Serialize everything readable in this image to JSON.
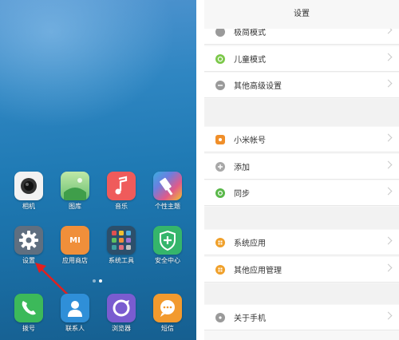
{
  "home": {
    "apps": [
      {
        "label": "相机",
        "icon": "camera-icon",
        "color": "#f2f2f2"
      },
      {
        "label": "图库",
        "icon": "gallery-icon",
        "color": "#8fd28a"
      },
      {
        "label": "音乐",
        "icon": "music-icon",
        "color": "#ef5b5b"
      },
      {
        "label": "个性主题",
        "icon": "theme-icon",
        "color": "#3aaee0"
      },
      {
        "label": "设置",
        "icon": "gear-icon",
        "color": "#5f6f80"
      },
      {
        "label": "应用商店",
        "icon": "app-store-icon",
        "color": "#f08f3a"
      },
      {
        "label": "系统工具",
        "icon": "system-tools-folder-icon",
        "color": "#2c4f6b"
      },
      {
        "label": "安全中心",
        "icon": "security-shield-icon",
        "color": "#35b56b"
      }
    ],
    "dock": [
      {
        "label": "拨号",
        "icon": "phone-icon",
        "color": "#3cb95a"
      },
      {
        "label": "联系人",
        "icon": "contacts-icon",
        "color": "#2f8fd8"
      },
      {
        "label": "浏览器",
        "icon": "browser-icon",
        "color": "#7a5cd0"
      },
      {
        "label": "短信",
        "icon": "sms-icon",
        "color": "#f29a2e"
      }
    ],
    "store_badge": "MI"
  },
  "settings": {
    "title": "设置",
    "items": [
      {
        "label": "极简模式",
        "icon": "simple-mode-icon",
        "color": "#9a9a9a"
      },
      {
        "label": "儿童模式",
        "icon": "kid-mode-icon",
        "color": "#7cc84a"
      },
      {
        "label": "其他高级设置",
        "icon": "advanced-settings-icon",
        "color": "#9a9a9a"
      },
      {
        "label": "小米帐号",
        "icon": "mi-account-icon",
        "color": "#f08f2a"
      },
      {
        "label": "添加",
        "icon": "add-icon",
        "color": "#a8a8a8"
      },
      {
        "label": "同步",
        "icon": "sync-icon",
        "color": "#5ab84a"
      },
      {
        "label": "系统应用",
        "icon": "system-apps-icon",
        "color": "#f0a02a"
      },
      {
        "label": "其他应用管理",
        "icon": "app-manage-icon",
        "color": "#f0a02a"
      },
      {
        "label": "关于手机",
        "icon": "about-phone-icon",
        "color": "#9a9a9a"
      }
    ]
  },
  "colors": {
    "arrow": "#e02020",
    "settings_bg": "#f7f7f7"
  }
}
